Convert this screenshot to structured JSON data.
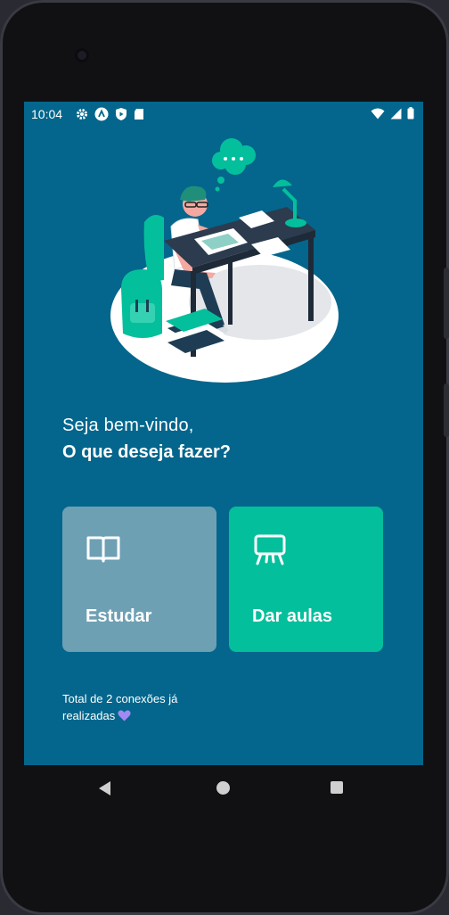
{
  "status": {
    "time": "10:04",
    "left_icons": [
      "gear-icon",
      "android-a-icon",
      "shield-play-icon",
      "sd-card-icon"
    ],
    "right_icons": [
      "wifi-icon",
      "signal-icon",
      "battery-icon"
    ]
  },
  "greeting": {
    "line1": "Seja bem-vindo,",
    "line2": "O que deseja fazer?"
  },
  "actions": {
    "study": {
      "label": "Estudar",
      "icon": "book-open-icon",
      "color": "#6ea0b4"
    },
    "teach": {
      "label": "Dar aulas",
      "icon": "presentation-board-icon",
      "color": "#04bf9c"
    }
  },
  "footer": {
    "line1": "Total de 2 conexões já",
    "line2": "realizadas"
  },
  "colors": {
    "background": "#04668c",
    "accent": "#04bf9c",
    "heart": "#a389f4"
  },
  "nav": {
    "icons": [
      "back-icon",
      "home-icon",
      "recents-icon"
    ]
  }
}
